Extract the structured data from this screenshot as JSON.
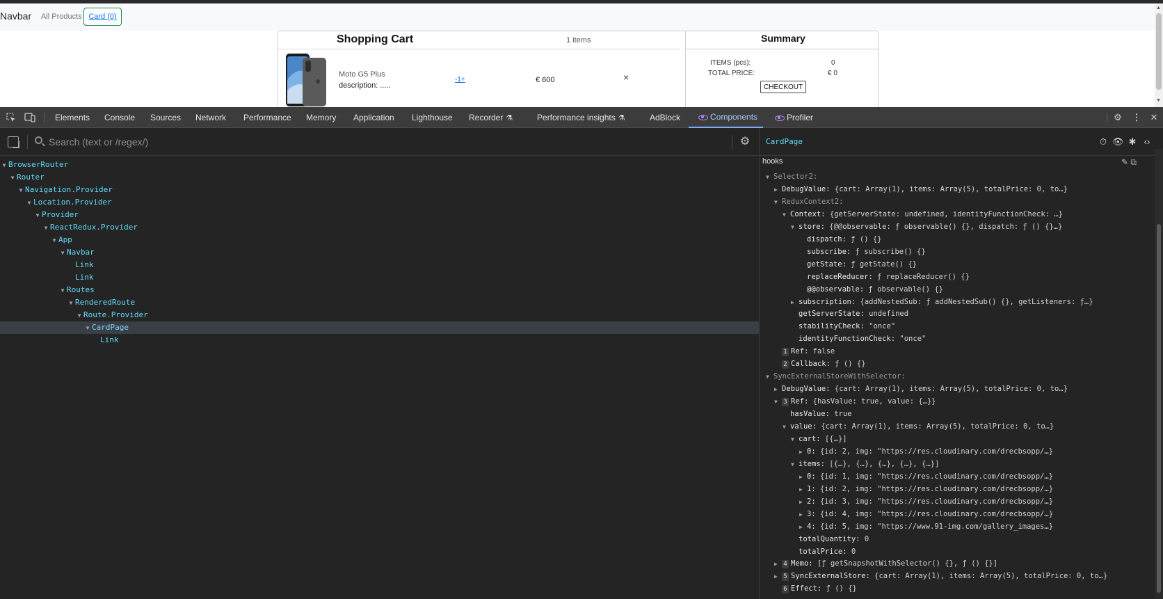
{
  "site": {
    "brand": "Navbar",
    "nav_all_products": "All Products",
    "nav_card": "Card (0)",
    "cart_title": "Shopping Cart",
    "cart_count": "1 items",
    "item": {
      "name": "Moto G5 Plus",
      "description": "description: .....",
      "qty": "-1+",
      "price": "€ 600",
      "remove": "×"
    },
    "summary": {
      "title": "Summary",
      "items_label": "ITEMS (pcs):",
      "items_value": "0",
      "total_label": "TOTAL PRICE:",
      "total_value": "€ 0",
      "checkout": "CHECKOUT"
    }
  },
  "devtools": {
    "tabs": [
      {
        "label": "Elements"
      },
      {
        "label": "Console"
      },
      {
        "label": "Sources"
      },
      {
        "label": "Network"
      },
      {
        "label": "Performance"
      },
      {
        "label": "Memory"
      },
      {
        "label": "Application"
      },
      {
        "label": "Lighthouse"
      },
      {
        "label": "Recorder"
      },
      {
        "label": "Performance insights"
      },
      {
        "label": "AdBlock"
      },
      {
        "label": "Components"
      },
      {
        "label": "Profiler"
      }
    ],
    "active_tab": "Components",
    "search_placeholder": "Search (text or /regex/)",
    "tree": [
      {
        "label": "BrowserRouter",
        "depth": 0,
        "expanded": true
      },
      {
        "label": "Router",
        "depth": 1,
        "expanded": true
      },
      {
        "label": "Navigation.Provider",
        "depth": 2,
        "expanded": true
      },
      {
        "label": "Location.Provider",
        "depth": 3,
        "expanded": true
      },
      {
        "label": "Provider",
        "depth": 4,
        "expanded": true
      },
      {
        "label": "ReactRedux.Provider",
        "depth": 5,
        "expanded": true
      },
      {
        "label": "App",
        "depth": 6,
        "expanded": true
      },
      {
        "label": "Navbar",
        "depth": 7,
        "expanded": true
      },
      {
        "label": "Link",
        "depth": 8,
        "expanded": null
      },
      {
        "label": "Link",
        "depth": 8,
        "expanded": null
      },
      {
        "label": "Routes",
        "depth": 7,
        "expanded": true
      },
      {
        "label": "RenderedRoute",
        "depth": 8,
        "expanded": true
      },
      {
        "label": "Route.Provider",
        "depth": 9,
        "expanded": true
      },
      {
        "label": "CardPage",
        "depth": 10,
        "expanded": true,
        "selected": true
      },
      {
        "label": "Link",
        "depth": 11,
        "expanded": null
      }
    ],
    "selected_component": "CardPage",
    "hooks_title": "hooks",
    "props": [
      {
        "d": 0,
        "c": "open",
        "k": "Selector2:",
        "dim": true,
        "v": ""
      },
      {
        "d": 1,
        "c": "closed",
        "k": "DebugValue:",
        "v": "{cart: Array(1), items: Array(5), totalPrice: 0, to…}"
      },
      {
        "d": 1,
        "c": "open",
        "k": "ReduxContext2:",
        "dim": true,
        "v": ""
      },
      {
        "d": 2,
        "c": "open",
        "k": "Context:",
        "v": "{getServerState: undefined, identityFunctionCheck: …}"
      },
      {
        "d": 3,
        "c": "open",
        "k": "store:",
        "v": "{@@observable: ƒ observable() {}, dispatch: ƒ () {}…}"
      },
      {
        "d": 4,
        "c": "",
        "k": "dispatch:",
        "v": "ƒ () {}"
      },
      {
        "d": 4,
        "c": "",
        "k": "subscribe:",
        "v": "ƒ subscribe() {}"
      },
      {
        "d": 4,
        "c": "",
        "k": "getState:",
        "v": "ƒ getState() {}"
      },
      {
        "d": 4,
        "c": "",
        "k": "replaceReducer:",
        "v": "ƒ replaceReducer() {}"
      },
      {
        "d": 4,
        "c": "",
        "k": "@@observable:",
        "v": "ƒ observable() {}"
      },
      {
        "d": 3,
        "c": "closed",
        "k": "subscription:",
        "v": "{addNestedSub: ƒ addNestedSub() {}, getListeners: ƒ…}"
      },
      {
        "d": 3,
        "c": "",
        "k": "getServerState:",
        "v": "undefined"
      },
      {
        "d": 3,
        "c": "",
        "k": "stabilityCheck:",
        "v": "\"once\""
      },
      {
        "d": 3,
        "c": "",
        "k": "identityFunctionCheck:",
        "v": "\"once\""
      },
      {
        "d": 1,
        "c": "",
        "idx": "1",
        "k": "Ref:",
        "v": "false"
      },
      {
        "d": 1,
        "c": "",
        "idx": "2",
        "k": "Callback:",
        "v": "ƒ () {}"
      },
      {
        "d": 0,
        "c": "open",
        "k": "SyncExternalStoreWithSelector:",
        "dim": true,
        "v": ""
      },
      {
        "d": 1,
        "c": "closed",
        "k": "DebugValue:",
        "v": "{cart: Array(1), items: Array(5), totalPrice: 0, to…}"
      },
      {
        "d": 1,
        "c": "open",
        "idx": "3",
        "k": "Ref:",
        "v": "{hasValue: true, value: {…}}"
      },
      {
        "d": 2,
        "c": "",
        "k": "hasValue:",
        "v": "true"
      },
      {
        "d": 2,
        "c": "open",
        "k": "value:",
        "v": "{cart: Array(1), items: Array(5), totalPrice: 0, to…}"
      },
      {
        "d": 3,
        "c": "open",
        "k": "cart:",
        "v": "[{…}]"
      },
      {
        "d": 4,
        "c": "closed",
        "k": "0:",
        "v": "{id: 2, img: \"https://res.cloudinary.com/drecbsopp/…}"
      },
      {
        "d": 3,
        "c": "open",
        "k": "items:",
        "v": "[{…}, {…}, {…}, {…}, {…}]"
      },
      {
        "d": 4,
        "c": "closed",
        "k": "0:",
        "v": "{id: 1, img: \"https://res.cloudinary.com/drecbsopp/…}"
      },
      {
        "d": 4,
        "c": "closed",
        "k": "1:",
        "v": "{id: 2, img: \"https://res.cloudinary.com/drecbsopp/…}"
      },
      {
        "d": 4,
        "c": "closed",
        "k": "2:",
        "v": "{id: 3, img: \"https://res.cloudinary.com/drecbsopp/…}"
      },
      {
        "d": 4,
        "c": "closed",
        "k": "3:",
        "v": "{id: 4, img: \"https://res.cloudinary.com/drecbsopp/…}"
      },
      {
        "d": 4,
        "c": "closed",
        "k": "4:",
        "v": "{id: 5, img: \"https://www.91-img.com/gallery_images…}"
      },
      {
        "d": 3,
        "c": "",
        "k": "totalQuantity:",
        "v": "0"
      },
      {
        "d": 3,
        "c": "",
        "k": "totalPrice:",
        "v": "0"
      },
      {
        "d": 1,
        "c": "closed",
        "idx": "4",
        "k": "Memo:",
        "v": "[ƒ getSnapshotWithSelector() {}, ƒ () {}]"
      },
      {
        "d": 1,
        "c": "closed",
        "idx": "5",
        "k": "SyncExternalStore:",
        "v": "{cart: Array(1), items: Array(5), totalPrice: 0, to…}"
      },
      {
        "d": 1,
        "c": "",
        "idx": "6",
        "k": "Effect:",
        "v": "ƒ () {}"
      }
    ]
  }
}
